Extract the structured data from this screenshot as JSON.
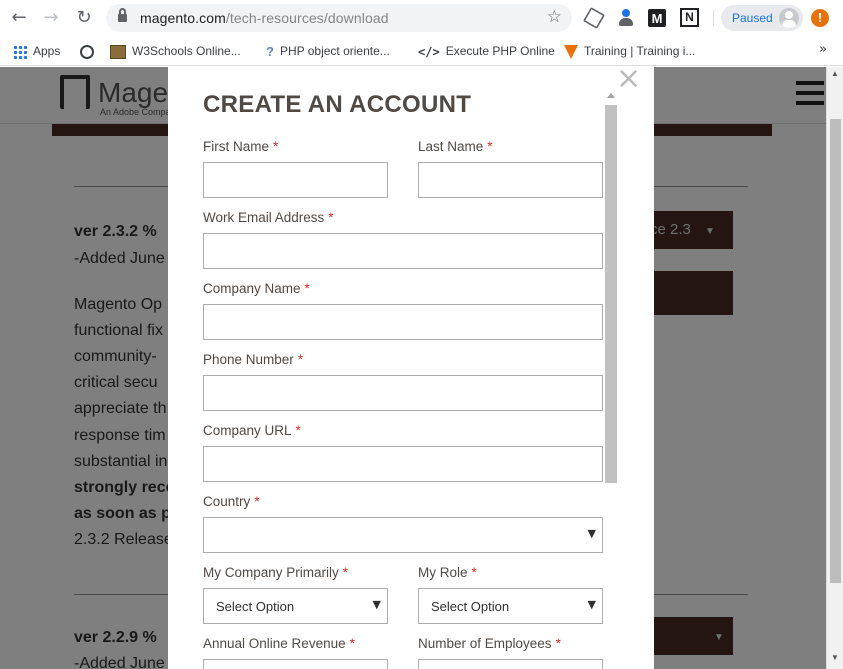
{
  "browser": {
    "url_domain": "magento.com",
    "url_path": "/tech-resources/download",
    "profile_status": "Paused",
    "update_badge": "!"
  },
  "bookmarks": [
    {
      "label": "Apps"
    },
    {
      "label": "W3Schools Online..."
    },
    {
      "label": "PHP object oriente..."
    },
    {
      "label": "Execute PHP Online"
    },
    {
      "label": "Training | Training i..."
    }
  ],
  "background_page": {
    "logo_text": "Magento",
    "logo_sub": "An Adobe Company",
    "release_1": {
      "version": "ver 2.3.2 %",
      "date": "-Added June",
      "paragraph_lines": [
        "Magento Op",
        "functional fix",
        "community-",
        "critical secu",
        "appreciate th",
        "response tim",
        "substantial in"
      ],
      "bold_lines": [
        "strongly reco",
        "as soon as p"
      ],
      "notes": "2.3.2 Release",
      "select_value": "ce 2.3"
    },
    "release_2": {
      "version": "ver 2.2.9 %",
      "date": "-Added June"
    }
  },
  "modal": {
    "close_glyph": "×",
    "title": "CREATE AN ACCOUNT",
    "required_mark": "*",
    "fields": {
      "first_name": "First Name",
      "last_name": "Last Name",
      "work_email": "Work Email Address",
      "company_name": "Company Name",
      "phone": "Phone Number",
      "company_url": "Company URL",
      "country": "Country",
      "company_primarily": "My Company Primarily",
      "role": "My Role",
      "revenue": "Annual Online Revenue",
      "employees": "Number of Employees"
    },
    "select_placeholder": "Select Option"
  }
}
